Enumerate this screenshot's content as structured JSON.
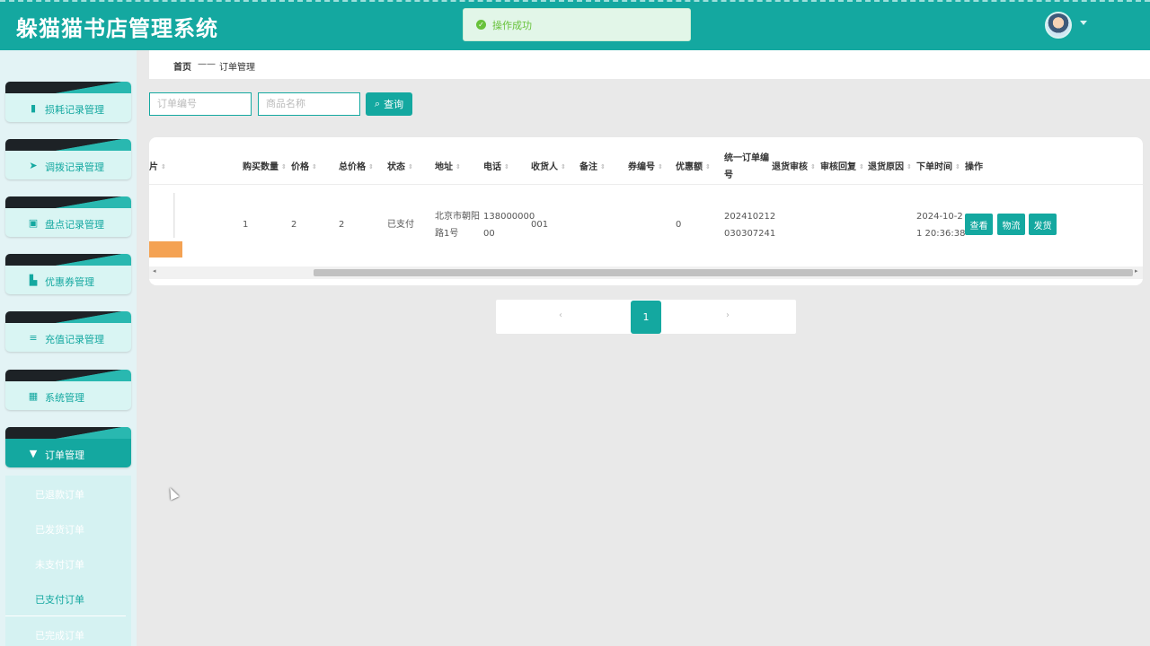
{
  "header": {
    "app_title": "躲猫猫书店管理系统",
    "toast": "操作成功",
    "avatar_icon": "user-avatar",
    "brand_color": "#14a8a0"
  },
  "sidebar": {
    "items": [
      {
        "label": "损耗记录管理",
        "icon": "bar-chart-icon"
      },
      {
        "label": "调拨记录管理",
        "icon": "send-icon"
      },
      {
        "label": "盘点记录管理",
        "icon": "clipboard-icon"
      },
      {
        "label": "优惠券管理",
        "icon": "coupon-icon"
      },
      {
        "label": "充值记录管理",
        "icon": "sliders-icon"
      },
      {
        "label": "系统管理",
        "icon": "grid-icon"
      },
      {
        "label": "订单管理",
        "icon": "order-icon"
      }
    ],
    "submenu": [
      "已退款订单",
      "已发货订单",
      "未支付订单",
      "已支付订单",
      "已完成订单"
    ]
  },
  "breadcrumb": {
    "home": "首页",
    "separator": "——",
    "current": "订单管理"
  },
  "search": {
    "order_no_placeholder": "订单编号",
    "product_name_placeholder": "商品名称",
    "query_label": "查询"
  },
  "table": {
    "headers": {
      "image": "片",
      "quantity": "购买数量",
      "price": "价格",
      "total": "总价格",
      "status": "状态",
      "address": "地址",
      "phone": "电话",
      "receiver": "收货人",
      "remark": "备注",
      "coupon_no": "券编号",
      "discount": "优惠额",
      "unified_order_no_1": "统一订单编",
      "unified_order_no_2": "号",
      "refund_review": "退货审核",
      "review_reply": "审核回复",
      "refund_reason": "退货原因",
      "order_time": "下单时间",
      "actions": "操作"
    },
    "rows": [
      {
        "quantity": "1",
        "price": "2",
        "total": "2",
        "status": "已支付",
        "address_1": "北京市朝阳",
        "address_2": "路1号",
        "phone_1": "138000000",
        "phone_2": "00",
        "receiver": "001",
        "discount": "0",
        "unified_order_no_1": "202410212",
        "unified_order_no_2": "030307241",
        "order_time_1": "2024-10-2",
        "order_time_2": "1 20:36:38",
        "btn_view": "查看",
        "btn_logistics": "物流",
        "btn_ship": "发货"
      }
    ]
  },
  "pagination": {
    "prev": "‹",
    "current": "1",
    "next": "›"
  }
}
